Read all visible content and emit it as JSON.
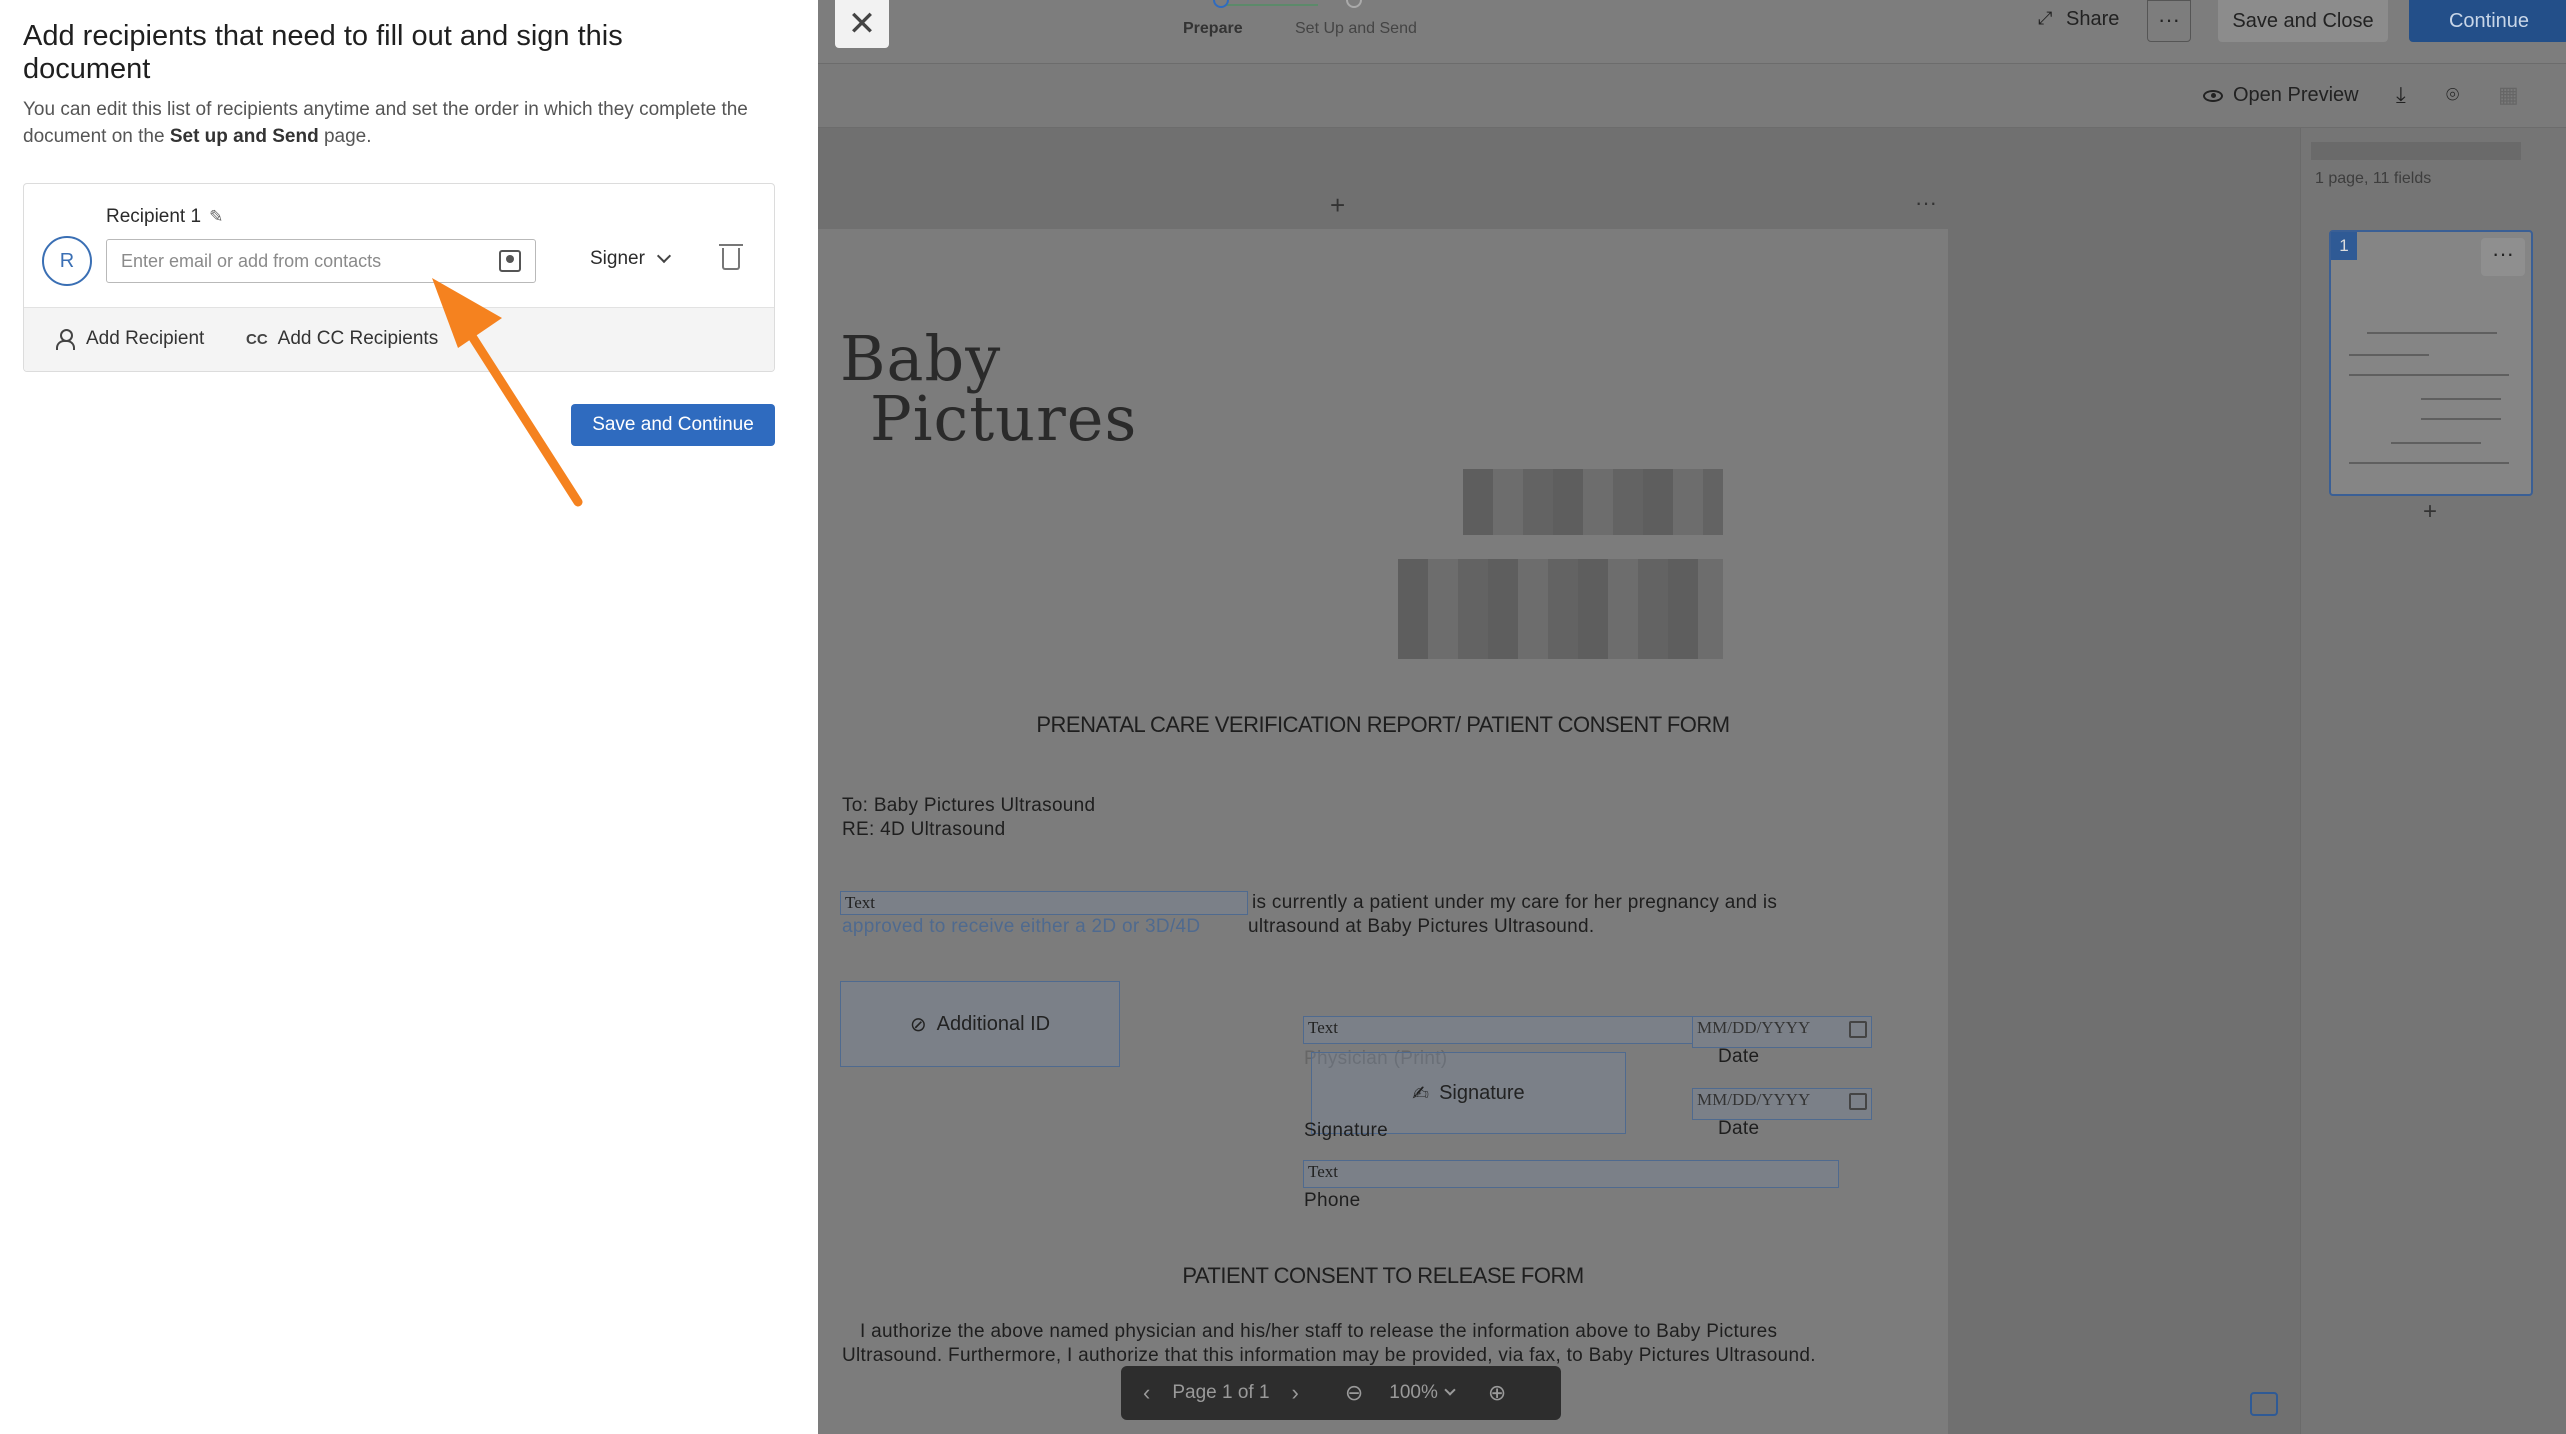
{
  "recipients_panel": {
    "title": "Add recipients that need to fill out and sign this document",
    "description_part1": "You can edit this list of recipients anytime and set the order in which they complete the document on the ",
    "description_bold": "Set up and Send",
    "description_part2": " page.",
    "recipient": {
      "label": "Recipient 1",
      "avatar_initial": "R",
      "email_placeholder": "Enter email or add from contacts",
      "email_value": "",
      "role": "Signer"
    },
    "add_recipient_label": "Add Recipient",
    "add_cc_label": "Add CC Recipients",
    "cc_icon_text": "CC",
    "save_continue_label": "Save and Continue"
  },
  "top_bar": {
    "close_symbol": "✕",
    "steps": [
      "Prepare",
      "Set Up and Send"
    ],
    "share_label": "Share",
    "more_symbol": "···",
    "save_close_label": "Save and Close",
    "continue_label": "Continue"
  },
  "toolbar": {
    "open_preview_label": "Open Preview"
  },
  "document": {
    "logo_line1": "Baby",
    "logo_line2": "Pictures",
    "heading1": "PRENATAL CARE VERIFICATION REPORT/ PATIENT CONSENT FORM",
    "to_line": "To:  Baby Pictures Ultrasound",
    "re_line": "RE:  4D Ultrasound",
    "para1_a": "is currently a patient under my care for her pregnancy and is",
    "para1_b": "approved to receive either a 2D or 3D/4D",
    "para1_c": "ultrasound at Baby Pictures Ultrasound.",
    "text_field_label": "Text",
    "date_placeholder": "MM/DD/YYYY",
    "date_label": "Date",
    "signature_label": "Signature",
    "signature_caption": "Signature",
    "phone_caption": "Phone",
    "physician_caption": "Physician (Print)",
    "additional_id_label": "Additional ID",
    "heading2": "PATIENT CONSENT TO RELEASE FORM",
    "para2": "I authorize the above named physician and his/her staff to release the information above to Baby Pictures Ultrasound.  Furthermore, I authorize that this information may be provided, via fax, to Baby Pictures Ultrasound."
  },
  "pager": {
    "page_label": "Page 1 of 1",
    "zoom": "100%"
  },
  "thumbnails": {
    "meta": "1 page, 11 fields",
    "page_number": "1"
  }
}
